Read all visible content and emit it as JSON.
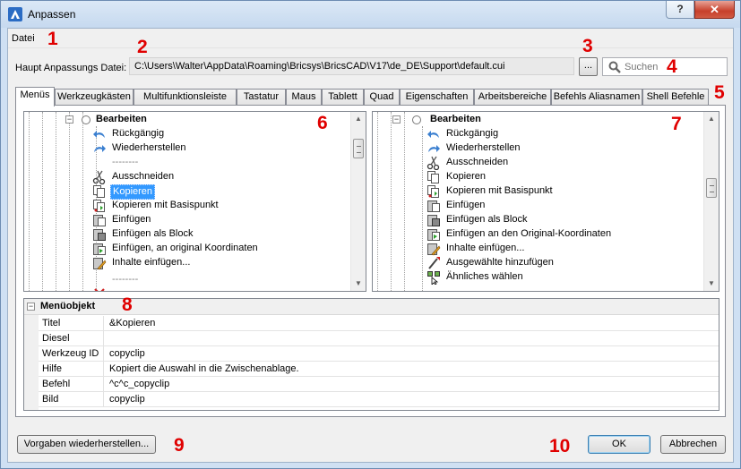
{
  "window": {
    "title": "Anpassen",
    "help_label": "?",
    "close_label": "✕"
  },
  "menubar": {
    "items": [
      "Datei"
    ]
  },
  "file": {
    "label": "Haupt Anpassungs Datei:",
    "path": "C:\\Users\\Walter\\AppData\\Roaming\\Bricsys\\BricsCAD\\V17\\de_DE\\Support\\default.cui",
    "browse_label": "..."
  },
  "search": {
    "placeholder": "Suchen"
  },
  "tabs": [
    "Menüs",
    "Werkzeugkästen",
    "Multifunktionsleiste",
    "Tastatur",
    "Maus",
    "Tablett",
    "Quad",
    "Eigenschaften",
    "Arbeitsbereiche",
    "Befehls Aliasnamen",
    "Shell Befehle"
  ],
  "left_tree": {
    "header": "Bearbeiten",
    "items": [
      {
        "label": "Rückgängig",
        "icon": "undo-icon"
      },
      {
        "label": "Wiederherstellen",
        "icon": "redo-icon"
      },
      {
        "label": "--------",
        "icon": "separator"
      },
      {
        "label": "Ausschneiden",
        "icon": "scissors-icon"
      },
      {
        "label": "Kopieren",
        "icon": "copy-icon",
        "selected": true
      },
      {
        "label": "Kopieren mit Basispunkt",
        "icon": "copy-base-icon"
      },
      {
        "label": "Einfügen",
        "icon": "paste-icon"
      },
      {
        "label": "Einfügen als Block",
        "icon": "paste-block-icon"
      },
      {
        "label": "Einfügen, an original  Koordinaten",
        "icon": "paste-orig-icon"
      },
      {
        "label": "Inhalte einfügen...",
        "icon": "paste-special-icon"
      },
      {
        "label": "--------",
        "icon": "separator"
      }
    ]
  },
  "right_tree": {
    "header": "Bearbeiten",
    "items": [
      {
        "label": "Rückgängig",
        "icon": "undo-icon"
      },
      {
        "label": "Wiederherstellen",
        "icon": "redo-icon"
      },
      {
        "label": "Ausschneiden",
        "icon": "scissors-icon"
      },
      {
        "label": "Kopieren",
        "icon": "copy-icon"
      },
      {
        "label": "Kopieren mit Basispunkt",
        "icon": "copy-base-icon"
      },
      {
        "label": "Einfügen",
        "icon": "paste-icon"
      },
      {
        "label": "Einfügen als Block",
        "icon": "paste-block-icon"
      },
      {
        "label": "Einfügen an den Original-Koordinaten",
        "icon": "paste-orig-icon"
      },
      {
        "label": "Inhalte einfügen...",
        "icon": "paste-special-icon"
      },
      {
        "label": "Ausgewählte hinzufügen",
        "icon": "add-selected-icon"
      },
      {
        "label": "Ähnliches wählen",
        "icon": "select-similar-icon"
      }
    ]
  },
  "properties": {
    "header": "Menüobjekt",
    "rows": [
      {
        "key": "Titel",
        "value": "&Kopieren"
      },
      {
        "key": "Diesel",
        "value": ""
      },
      {
        "key": "Werkzeug ID",
        "value": "copyclip"
      },
      {
        "key": "Hilfe",
        "value": "Kopiert die Auswahl in die Zwischenablage."
      },
      {
        "key": "Befehl",
        "value": "^c^c_copyclip"
      },
      {
        "key": "Bild",
        "value": "copyclip"
      }
    ]
  },
  "buttons": {
    "restore_label": "Vorgaben wiederherstellen...",
    "ok_label": "OK",
    "cancel_label": "Abbrechen"
  },
  "annotations": [
    "1",
    "2",
    "3",
    "4",
    "5",
    "6",
    "7",
    "8",
    "9",
    "10"
  ],
  "colors": {
    "annotation": "#e00000",
    "selection": "#3399ff",
    "close_button": "#c7402b"
  }
}
